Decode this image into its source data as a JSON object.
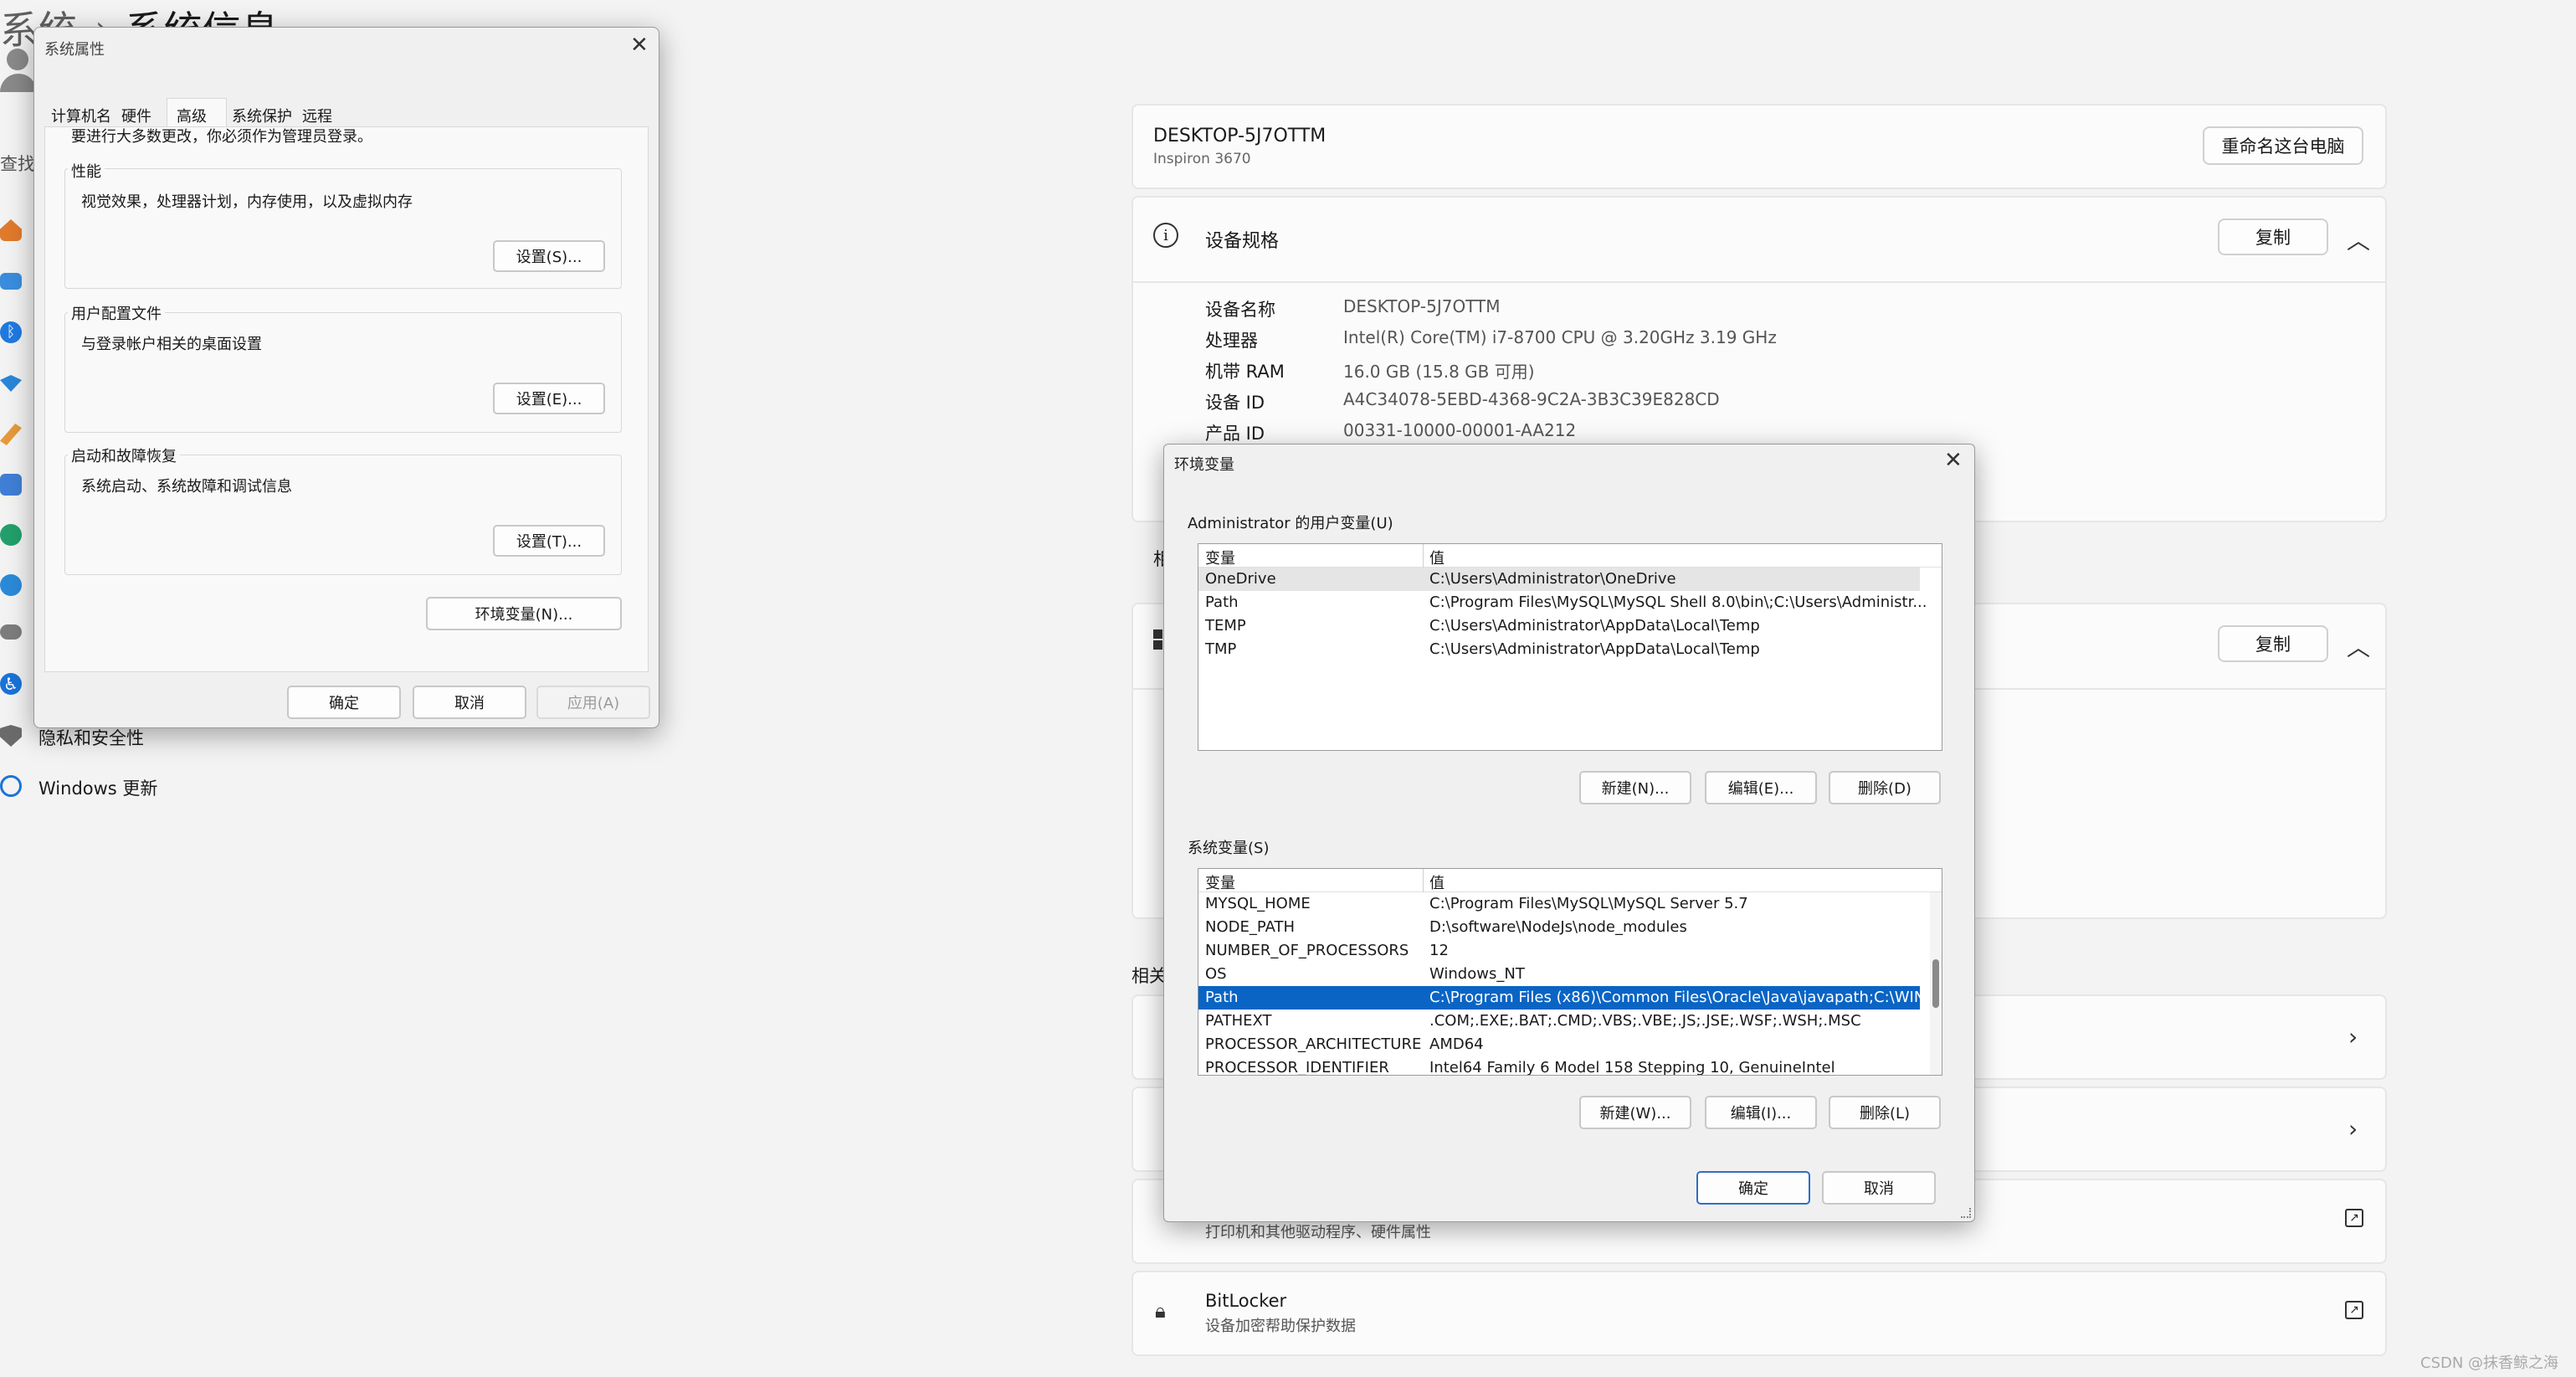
{
  "settings": {
    "breadcrumb": {
      "parent": "系统",
      "current": "系统信息"
    },
    "device_card": {
      "name": "DESKTOP-5J7OTTM",
      "model": "Inspiron 3670",
      "rename_button": "重命名这台电脑"
    },
    "specs_card": {
      "title": "设备规格",
      "copy_button": "复制",
      "rows": [
        {
          "key": "设备名称",
          "value": "DESKTOP-5J7OTTM"
        },
        {
          "key": "处理器",
          "value": "Intel(R) Core(TM) i7-8700 CPU @ 3.20GHz   3.19 GHz"
        },
        {
          "key": "机带 RAM",
          "value": "16.0 GB (15.8 GB 可用)"
        },
        {
          "key": "设备 ID",
          "value": "A4C34078-5EBD-4368-9C2A-3B3C39E828CD"
        },
        {
          "key": "产品 ID",
          "value": "00331-10000-00001-AA212"
        }
      ]
    },
    "partial_label_1": "相",
    "windows_card": {
      "copy_button": "复制"
    },
    "related_heading": "相关",
    "device_manager_sub": "打印机和其他驱动程序、硬件属性",
    "bitlocker": {
      "title": "BitLocker",
      "subtitle": "设备加密帮助保护数据"
    },
    "sidebar": {
      "search_partial": "查找",
      "items": [
        {
          "label": "隐私和安全性",
          "icon": "shield-icon"
        },
        {
          "label": "Windows 更新",
          "icon": "update-icon"
        }
      ]
    },
    "watermark": "CSDN @抹香鲸之海"
  },
  "sysprops": {
    "title": "系统属性",
    "tabs": [
      "计算机名",
      "硬件",
      "高级",
      "系统保护",
      "远程"
    ],
    "active_tab": "高级",
    "admin_note": "要进行大多数更改，你必须作为管理员登录。",
    "groups": [
      {
        "title": "性能",
        "desc": "视觉效果，处理器计划，内存使用，以及虚拟内存",
        "button": "设置(S)..."
      },
      {
        "title": "用户配置文件",
        "desc": "与登录帐户相关的桌面设置",
        "button": "设置(E)..."
      },
      {
        "title": "启动和故障恢复",
        "desc": "系统启动、系统故障和调试信息",
        "button": "设置(T)..."
      }
    ],
    "env_button": "环境变量(N)...",
    "ok": "确定",
    "cancel": "取消",
    "apply": "应用(A)"
  },
  "envvars": {
    "title": "环境变量",
    "user_section": "Administrator 的用户变量(U)",
    "col_var": "变量",
    "col_val": "值",
    "user_rows": [
      {
        "k": "OneDrive",
        "v": "C:\\Users\\Administrator\\OneDrive"
      },
      {
        "k": "Path",
        "v": "C:\\Program Files\\MySQL\\MySQL Shell 8.0\\bin\\;C:\\Users\\Administr..."
      },
      {
        "k": "TEMP",
        "v": "C:\\Users\\Administrator\\AppData\\Local\\Temp"
      },
      {
        "k": "TMP",
        "v": "C:\\Users\\Administrator\\AppData\\Local\\Temp"
      }
    ],
    "user_buttons": [
      "新建(N)...",
      "编辑(E)...",
      "删除(D)"
    ],
    "sys_section": "系统变量(S)",
    "sys_rows": [
      {
        "k": "MYSQL_HOME",
        "v": "C:\\Program Files\\MySQL\\MySQL Server 5.7"
      },
      {
        "k": "NODE_PATH",
        "v": "D:\\software\\NodeJs\\node_modules"
      },
      {
        "k": "NUMBER_OF_PROCESSORS",
        "v": "12"
      },
      {
        "k": "OS",
        "v": "Windows_NT"
      },
      {
        "k": "Path",
        "v": "C:\\Program Files (x86)\\Common Files\\Oracle\\Java\\javapath;C:\\WIN..."
      },
      {
        "k": "PATHEXT",
        "v": ".COM;.EXE;.BAT;.CMD;.VBS;.VBE;.JS;.JSE;.WSF;.WSH;.MSC"
      },
      {
        "k": "PROCESSOR_ARCHITECTURE",
        "v": "AMD64"
      },
      {
        "k": "PROCESSOR_IDENTIFIER",
        "v": "Intel64 Family 6 Model 158 Stepping 10, GenuineIntel"
      }
    ],
    "selected_sys_row": 4,
    "sys_buttons": [
      "新建(W)...",
      "编辑(I)...",
      "删除(L)"
    ],
    "ok": "确定",
    "cancel": "取消"
  },
  "colors": {
    "accent": "#0a64c4",
    "bg": "#f3f3f3",
    "card": "#fbfbfb"
  }
}
